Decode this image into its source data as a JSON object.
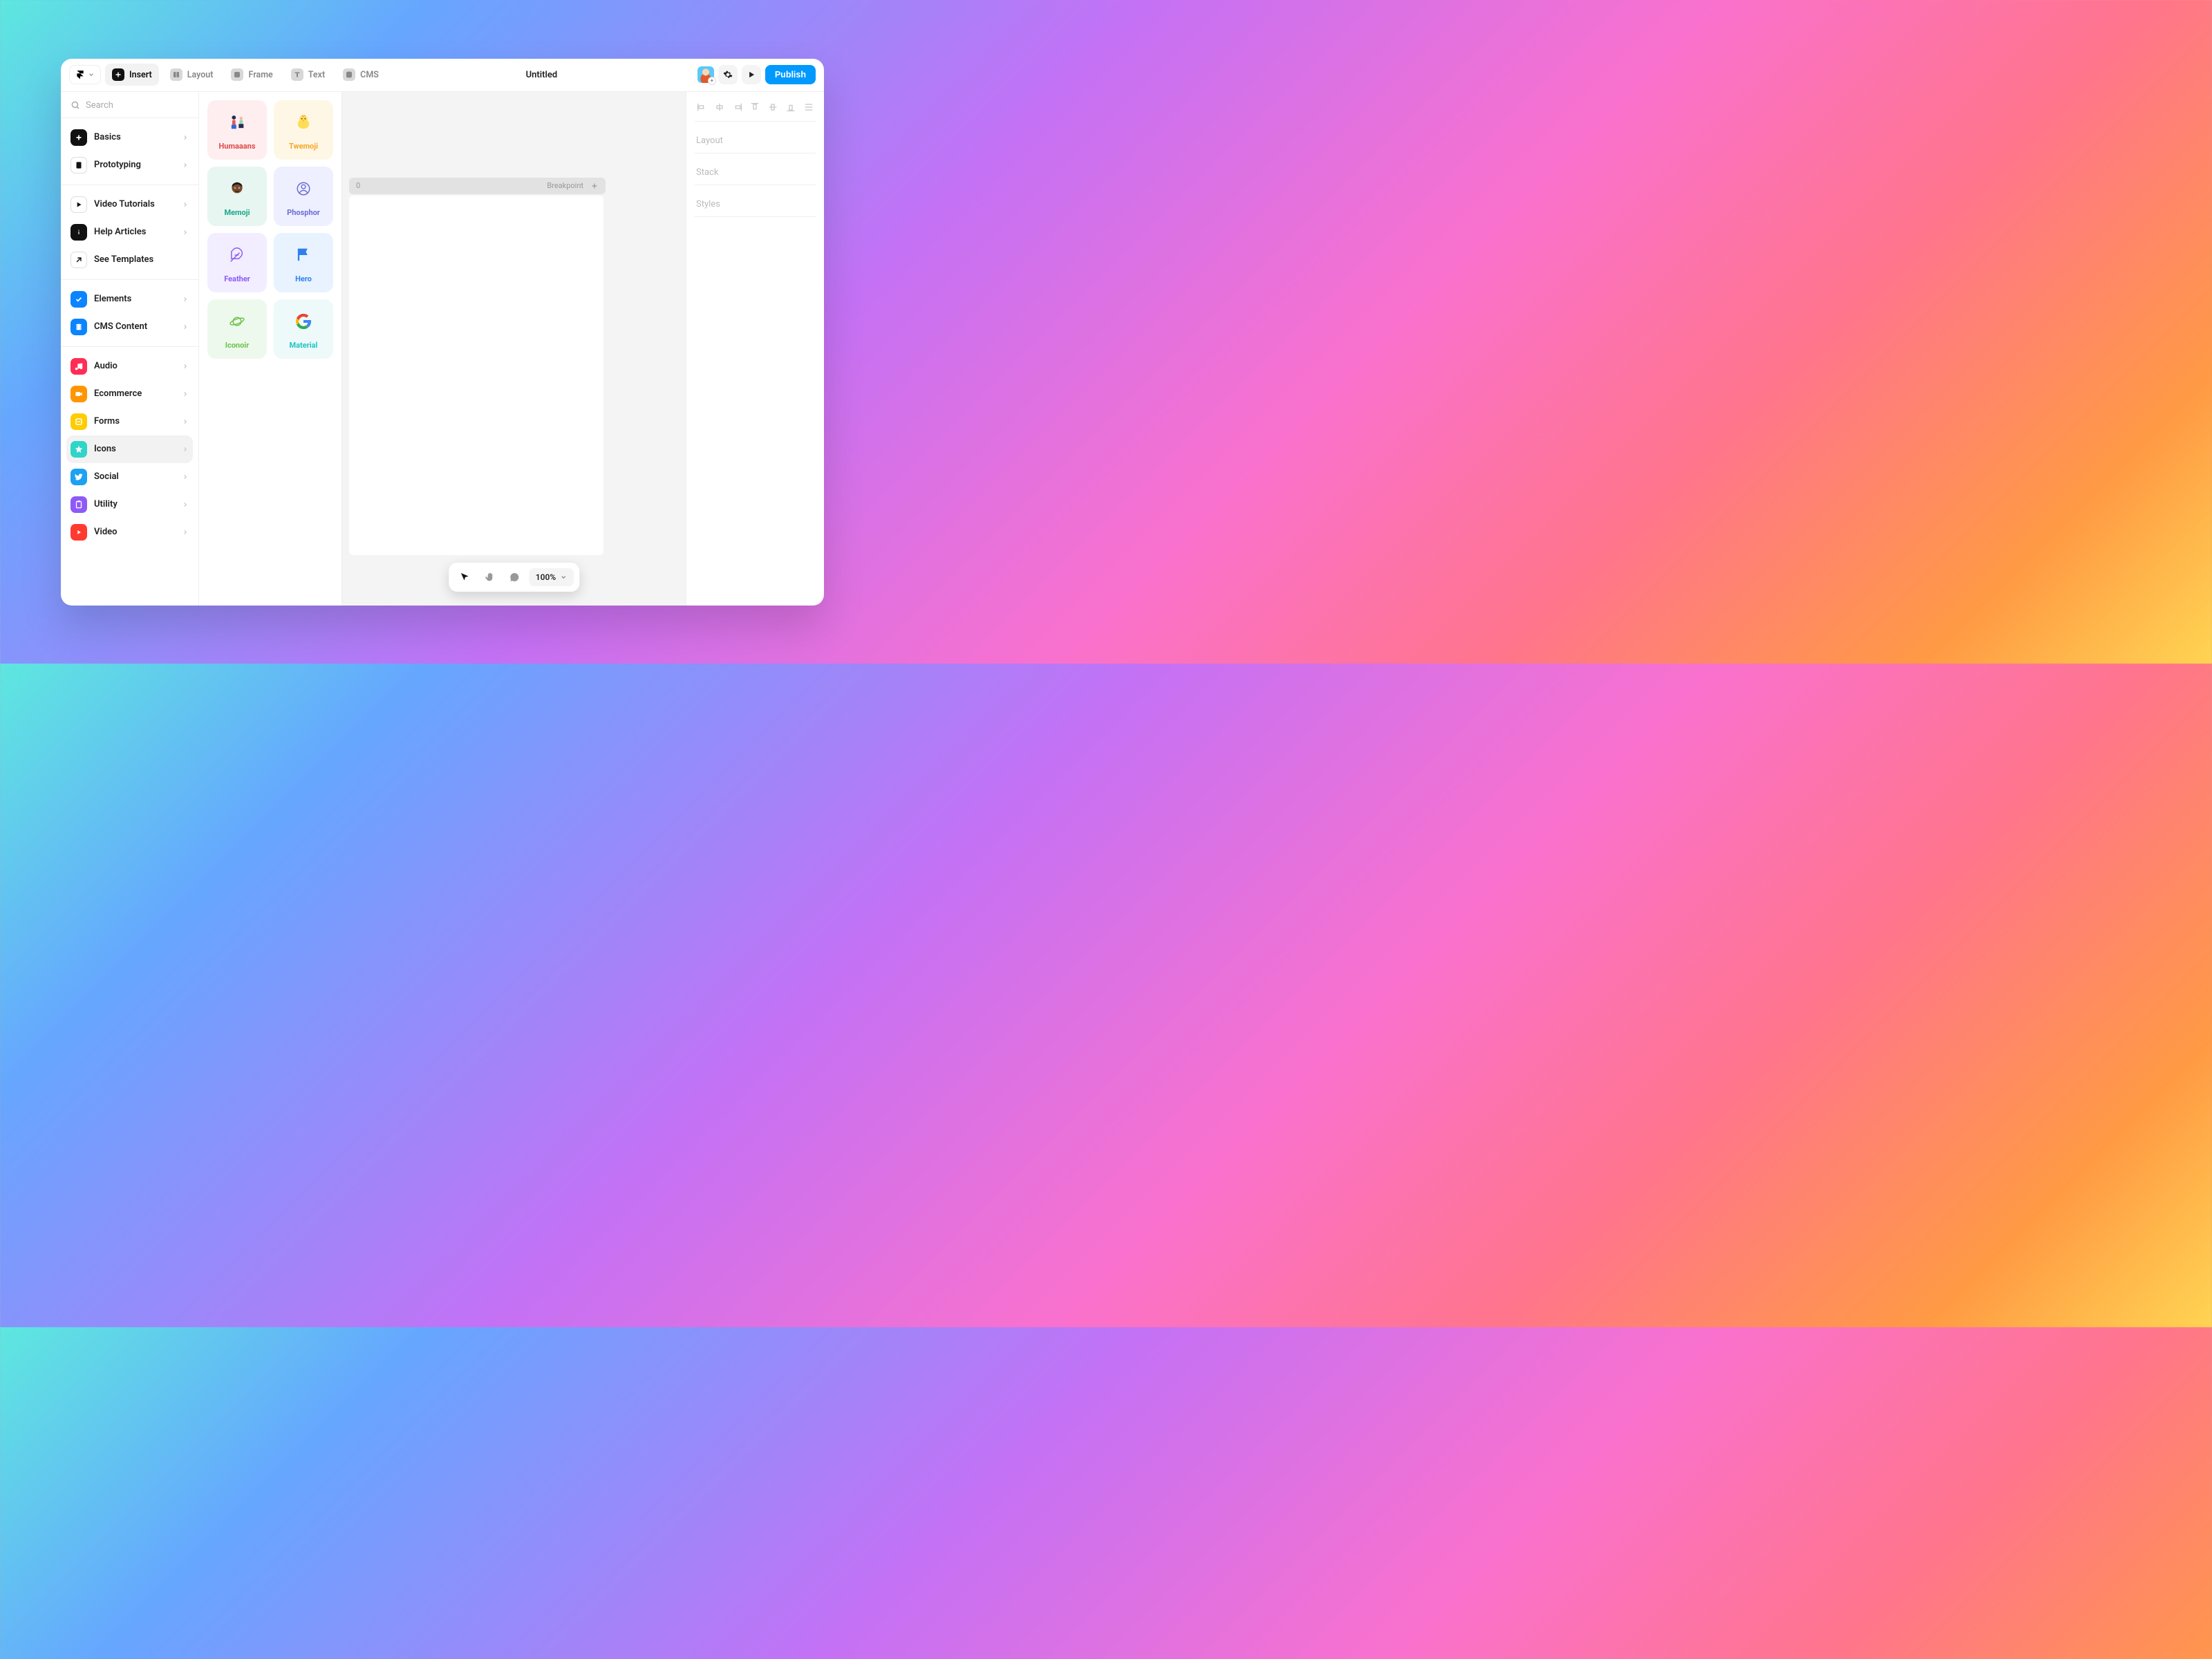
{
  "toolbar": {
    "insert": "Insert",
    "layout": "Layout",
    "frame": "Frame",
    "text": "Text",
    "cms": "CMS"
  },
  "title": "Untitled",
  "publish_label": "Publish",
  "search_placeholder": "Search",
  "sidebar": {
    "top": [
      {
        "label": "Basics"
      },
      {
        "label": "Prototyping"
      }
    ],
    "help": [
      {
        "label": "Video Tutorials"
      },
      {
        "label": "Help Articles"
      },
      {
        "label": "See Templates"
      }
    ],
    "content": [
      {
        "label": "Elements"
      },
      {
        "label": "CMS Content"
      }
    ],
    "assets": [
      {
        "label": "Audio"
      },
      {
        "label": "Ecommerce"
      },
      {
        "label": "Forms"
      },
      {
        "label": "Icons"
      },
      {
        "label": "Social"
      },
      {
        "label": "Utility"
      },
      {
        "label": "Video"
      }
    ]
  },
  "packs": [
    {
      "label": "Humaaans"
    },
    {
      "label": "Twemoji"
    },
    {
      "label": "Memoji"
    },
    {
      "label": "Phosphor"
    },
    {
      "label": "Feather"
    },
    {
      "label": "Hero"
    },
    {
      "label": "Iconoir"
    },
    {
      "label": "Material"
    }
  ],
  "canvas": {
    "breakpoint_num": "0",
    "breakpoint_label": "Breakpoint"
  },
  "bottom": {
    "zoom": "100%"
  },
  "right_panel": {
    "layout": "Layout",
    "stack": "Stack",
    "styles": "Styles"
  }
}
